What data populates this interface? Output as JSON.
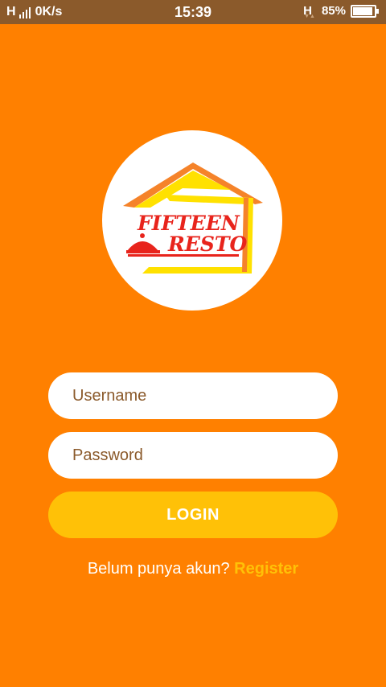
{
  "status_bar": {
    "signal_label": "H",
    "speed": "0K/s",
    "time": "15:39",
    "network_type": "H",
    "battery_percent": "85%",
    "battery_level": 0.85
  },
  "logo": {
    "line1": "FIFTEEN",
    "line2": "RESTO"
  },
  "form": {
    "username_placeholder": "Username",
    "password_placeholder": "Password",
    "login_label": "LOGIN"
  },
  "footer": {
    "prompt": "Belum punya akun? ",
    "register_label": "Register"
  },
  "colors": {
    "background": "#FF8000",
    "status_bar": "#8B5A2B",
    "button": "#FFC107",
    "link": "#FFC107",
    "logo_red": "#E8241C",
    "logo_yellow": "#FFE100",
    "logo_orange": "#F5832A"
  }
}
